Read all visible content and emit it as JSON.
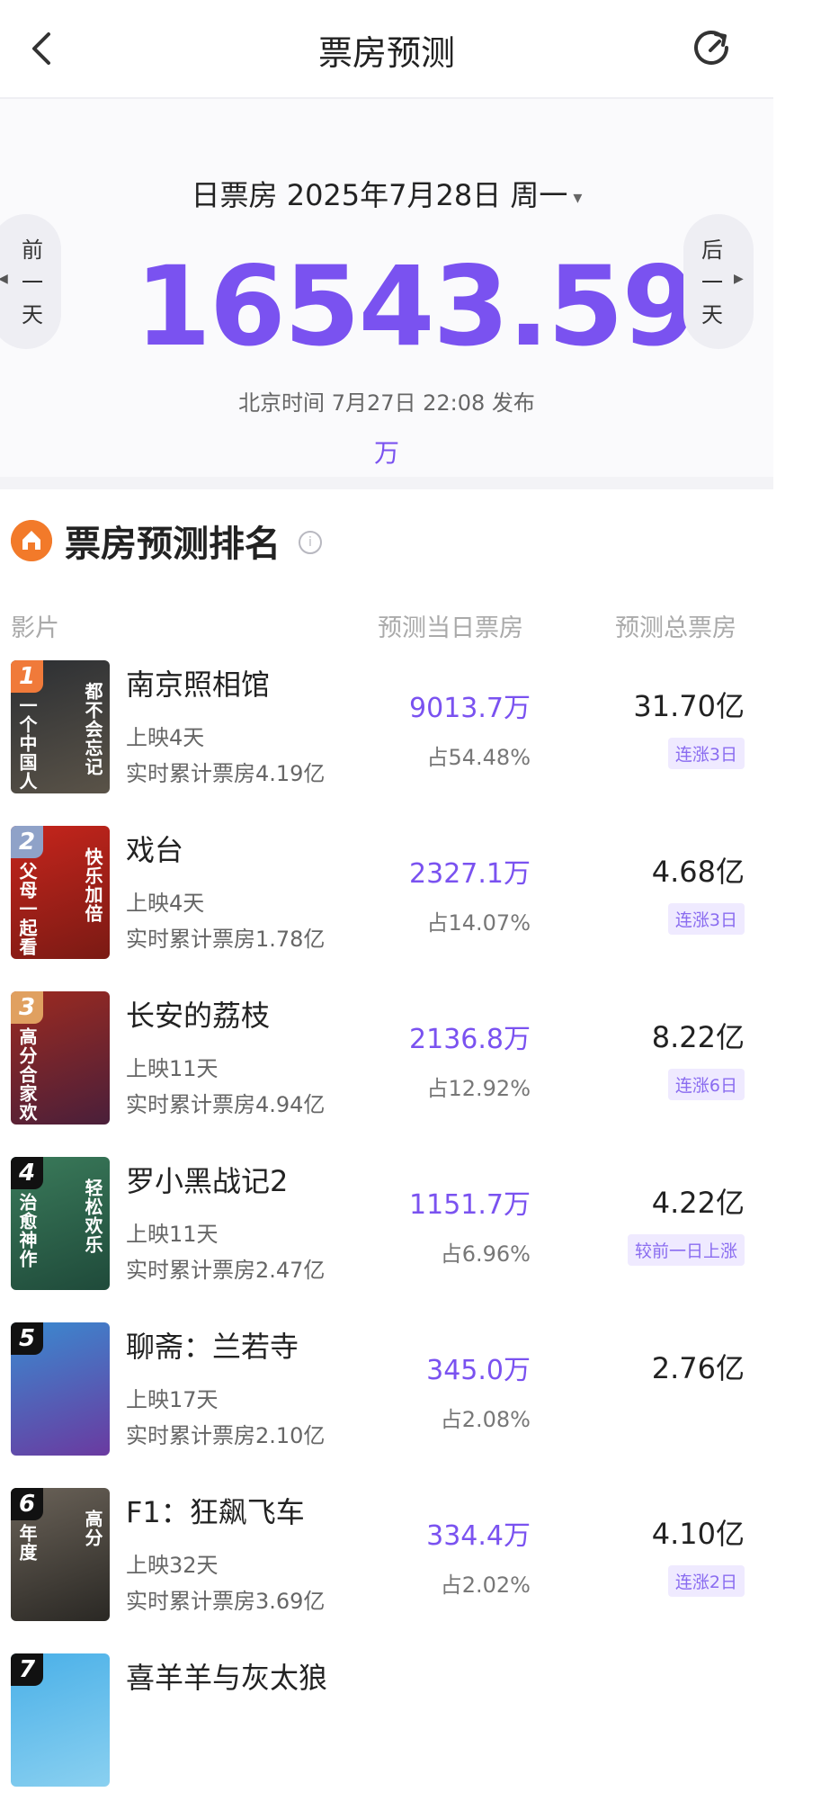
{
  "header": {
    "title": "票房预测"
  },
  "summary": {
    "date_label": "日票房 2025年7月28日 周一",
    "caret": "▾",
    "value": "16543.59",
    "unit": "万",
    "publish_time": "北京时间 7月27日 22:08 发布",
    "prev_label": "前一天",
    "next_label": "后一天"
  },
  "ranking": {
    "title": "票房预测排名",
    "col_film": "影片",
    "col_day": "预测当日票房",
    "col_total": "预测总票房"
  },
  "movies": [
    {
      "rank": "1",
      "title": "南京照相馆",
      "days": "上映4天",
      "cumulative": "实时累计票房4.19亿",
      "day_box": "9013.7万",
      "share": "占54.48%",
      "total": "31.70亿",
      "trend": "连涨3日",
      "poster_text": [
        "都不会忘记",
        "一个中国人"
      ],
      "poster_colors": [
        "#2c2f33",
        "#5a5348"
      ],
      "badge_color": "#f07a3a"
    },
    {
      "rank": "2",
      "title": "戏台",
      "days": "上映4天",
      "cumulative": "实时累计票房1.78亿",
      "day_box": "2327.1万",
      "share": "占14.07%",
      "total": "4.68亿",
      "trend": "连涨3日",
      "poster_text": [
        "快乐加倍",
        "父母一起看"
      ],
      "poster_colors": [
        "#c6251c",
        "#7a1a14"
      ],
      "badge_color": "#8fa2c8"
    },
    {
      "rank": "3",
      "title": "长安的荔枝",
      "days": "上映11天",
      "cumulative": "实时累计票房4.94亿",
      "day_box": "2136.8万",
      "share": "占12.92%",
      "total": "8.22亿",
      "trend": "连涨6日",
      "poster_text": [
        "",
        "高分合家欢"
      ],
      "poster_colors": [
        "#9c2a20",
        "#4a1f3a"
      ],
      "badge_color": "#e0a060"
    },
    {
      "rank": "4",
      "title": "罗小黑战记2",
      "days": "上映11天",
      "cumulative": "实时累计票房2.47亿",
      "day_box": "1151.7万",
      "share": "占6.96%",
      "total": "4.22亿",
      "trend": "较前一日上涨",
      "poster_text": [
        "轻松欢乐",
        "治愈神作"
      ],
      "poster_colors": [
        "#3a7a5a",
        "#1f4a3a"
      ],
      "badge_color": "#111111"
    },
    {
      "rank": "5",
      "title": "聊斋：兰若寺",
      "days": "上映17天",
      "cumulative": "实时累计票房2.10亿",
      "day_box": "345.0万",
      "share": "占2.08%",
      "total": "2.76亿",
      "trend": "",
      "poster_text": [
        "",
        ""
      ],
      "poster_colors": [
        "#3a8ad0",
        "#6a3aa0"
      ],
      "badge_color": "#111111"
    },
    {
      "rank": "6",
      "title": "F1：狂飙飞车",
      "days": "上映32天",
      "cumulative": "实时累计票房3.69亿",
      "day_box": "334.4万",
      "share": "占2.02%",
      "total": "4.10亿",
      "trend": "连涨2日",
      "poster_text": [
        "高分",
        "年度"
      ],
      "poster_colors": [
        "#6a6258",
        "#2a2824"
      ],
      "badge_color": "#111111"
    },
    {
      "rank": "7",
      "title": "喜羊羊与灰太狼",
      "days": "",
      "cumulative": "",
      "day_box": "",
      "share": "",
      "total": "",
      "trend": "",
      "poster_text": [
        "",
        ""
      ],
      "poster_colors": [
        "#4ab0e8",
        "#8ad0f0"
      ],
      "badge_color": "#111111"
    }
  ]
}
